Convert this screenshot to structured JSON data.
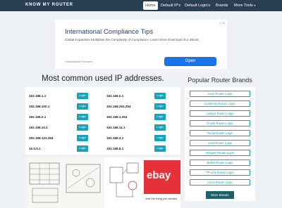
{
  "navbar": {
    "brand": "KNOW MY ROUTER",
    "items": [
      {
        "label": "Home"
      },
      {
        "label": "Default IP's"
      },
      {
        "label": "Default Login's"
      },
      {
        "label": "Brands"
      },
      {
        "label": "More Tools"
      }
    ],
    "caret": "▾"
  },
  "ad_top": {
    "title": "International Compliance Tips",
    "subtitle": "Global Expansion Multiplies the Complexity of Compliance. Learn More Download Our eBook.",
    "sponsor": "Globalization Partners",
    "open_label": "Open",
    "corner": "▷ ✕"
  },
  "ip_section": {
    "title": "Most common used IP addresses.",
    "login_label": "Login",
    "ips": [
      "192.168.1.1",
      "192.168.0.1",
      "192.168.100.1",
      "192.168.254.254",
      "192.168.2.1",
      "192.168.1.254",
      "192.168.10.1",
      "192.168.11.1",
      "192.168.123.254",
      "192.168.3.1",
      "10.0.0.1",
      "192.168.8.1"
    ]
  },
  "sidebar": {
    "title": "Popular Router Brands",
    "brands": [
      "Asus Router Login",
      "Comtrend Router Login",
      "Linksys Router Login",
      "D-Link Router Login",
      "Tenda Router Login",
      "Asus Router Login",
      "Netgear Router Login",
      "Belkin Router Login",
      "TP-Link Router Login",
      "Cisco Router Login"
    ],
    "more_label": "More Brands"
  },
  "ad_bottom": {
    "ebay_logo": "ebay",
    "ebay_text": "Just the thing you wanted"
  }
}
